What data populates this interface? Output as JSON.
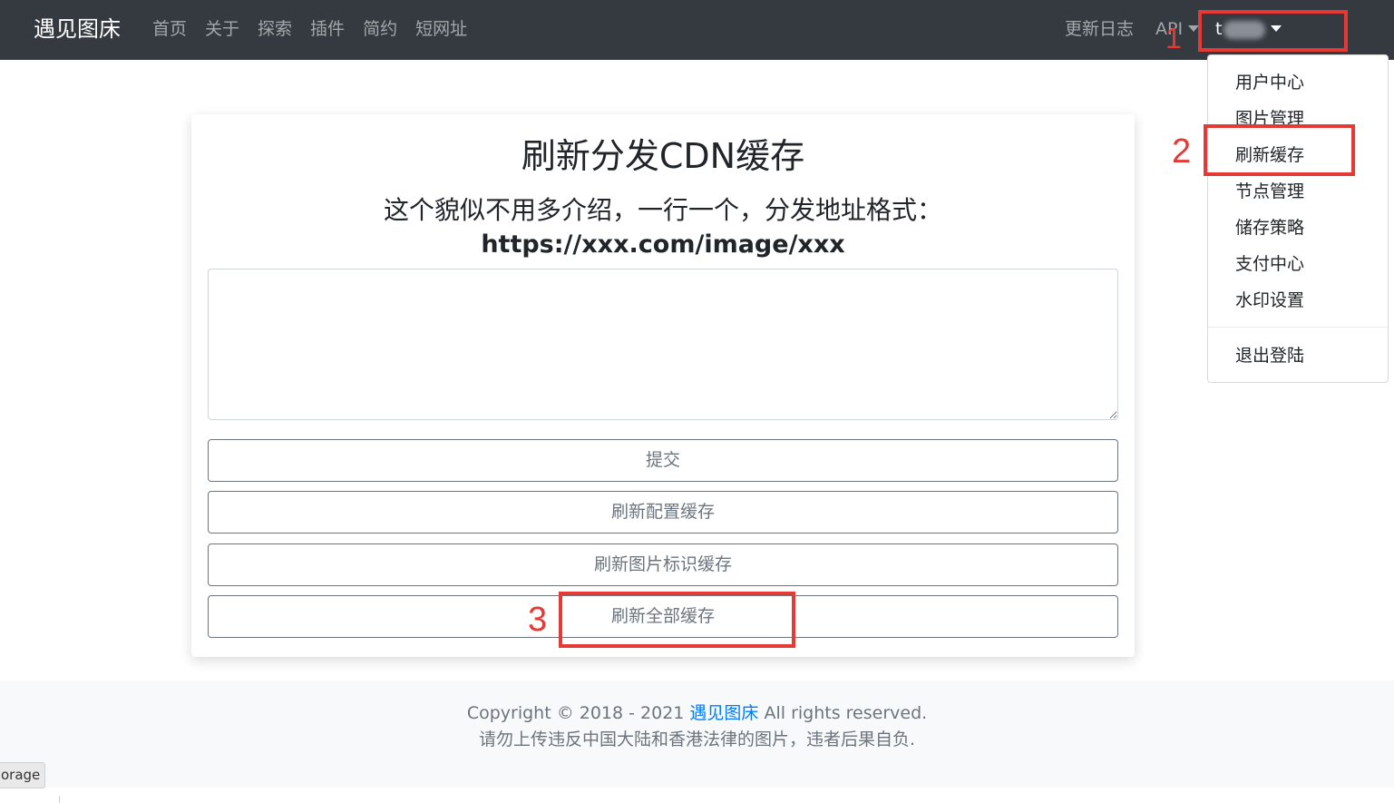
{
  "navbar": {
    "brand": "遇见图床",
    "links": [
      "首页",
      "关于",
      "探索",
      "插件",
      "简约",
      "短网址"
    ],
    "changelog": "更新日志",
    "api": "API",
    "user_initial": "t"
  },
  "dropdown": {
    "items": [
      "用户中心",
      "图片管理",
      "刷新缓存",
      "节点管理",
      "储存策略",
      "支付中心",
      "水印设置"
    ],
    "logout": "退出登陆"
  },
  "card": {
    "title": "刷新分发CDN缓存",
    "subtitle": "这个貌似不用多介绍，一行一个，分发地址格式：",
    "url_format": "https://xxx.com/image/xxx",
    "textarea_value": "",
    "buttons": [
      "提交",
      "刷新配置缓存",
      "刷新图片标识缓存",
      "刷新全部缓存"
    ]
  },
  "footer": {
    "copyright_prefix": "Copyright © 2018 - 2021 ",
    "site_link": "遇见图床",
    "copyright_suffix": " All rights reserved.",
    "notice": "请勿上传违反中国大陆和香港法律的图片，违者后果自负."
  },
  "storage_tab": "orage",
  "annotations": [
    "1",
    "2",
    "3"
  ],
  "colors": {
    "navbar_bg": "#343a40",
    "annotation_red": "#e53935",
    "link_blue": "#007bff",
    "footer_bg": "#f8f9fa"
  }
}
